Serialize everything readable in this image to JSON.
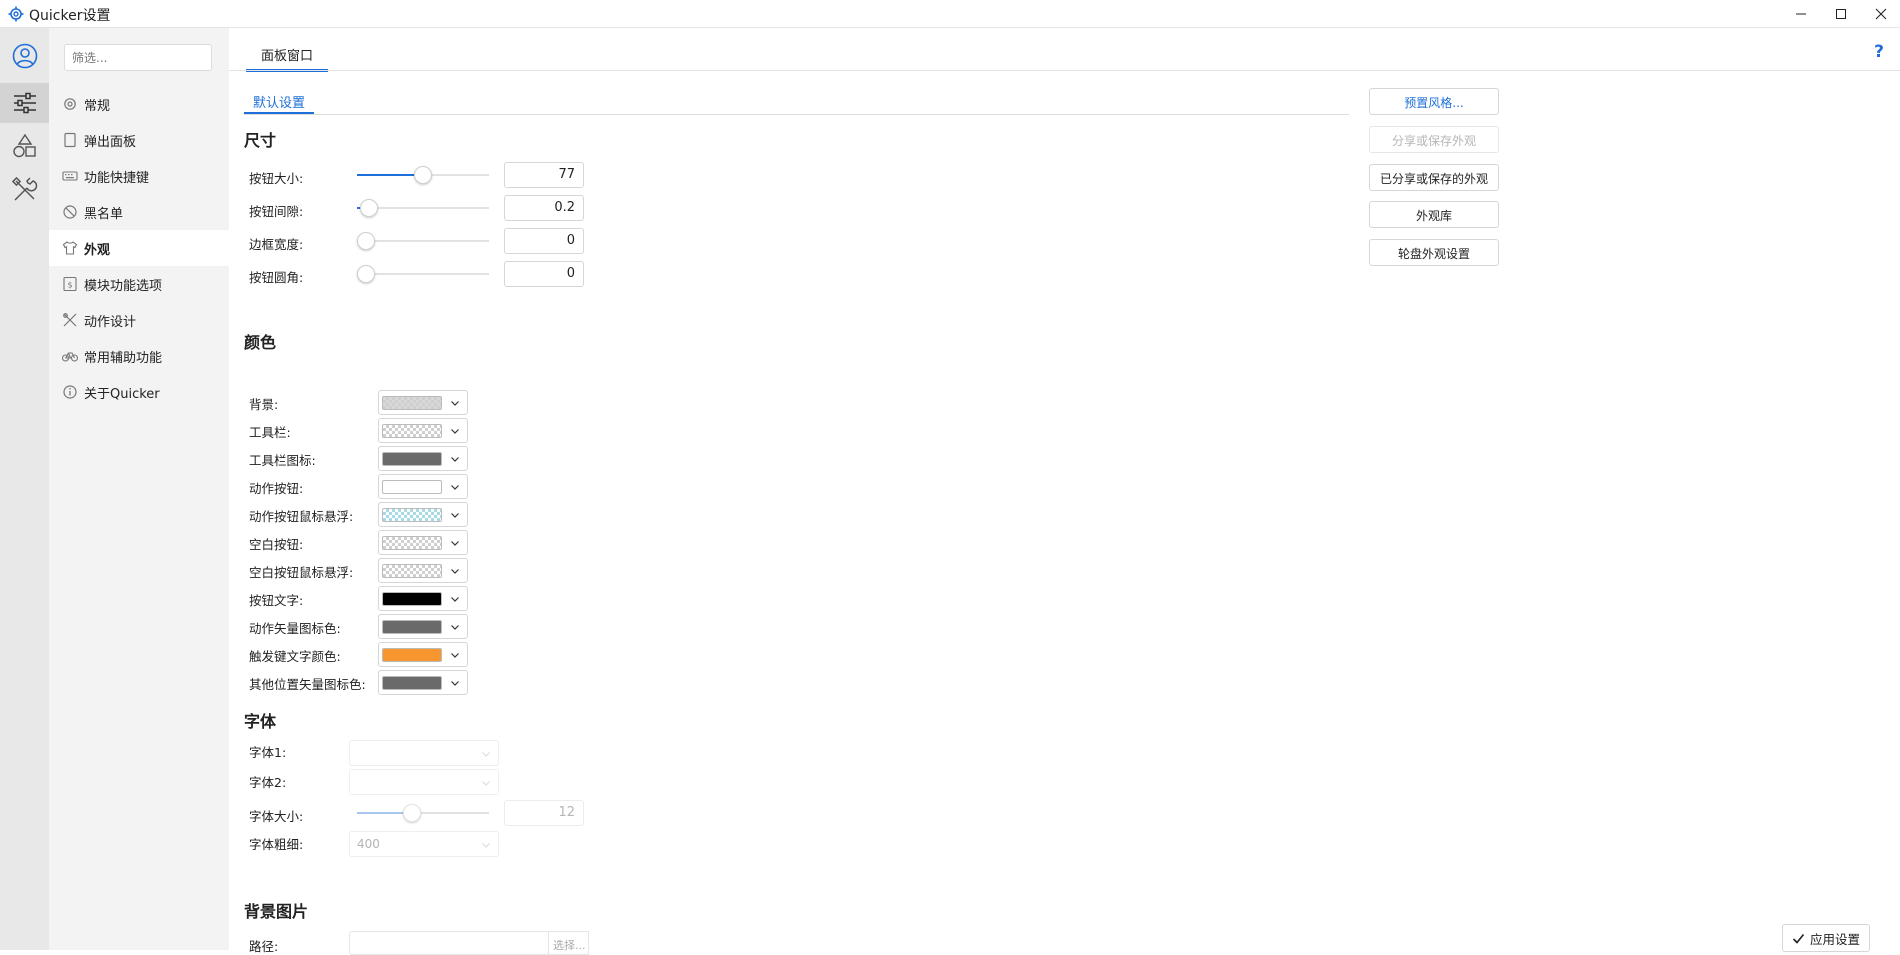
{
  "window": {
    "title": "Quicker设置"
  },
  "sidebar": {
    "filter_placeholder": "筛选...",
    "items": [
      {
        "label": "常规",
        "icon": "gear-icon"
      },
      {
        "label": "弹出面板",
        "icon": "panel-icon"
      },
      {
        "label": "功能快捷键",
        "icon": "keyboard-icon"
      },
      {
        "label": "黑名单",
        "icon": "ban-icon"
      },
      {
        "label": "外观",
        "icon": "shirt-icon",
        "active": true
      },
      {
        "label": "模块功能选项",
        "icon": "module-icon"
      },
      {
        "label": "动作设计",
        "icon": "design-icon"
      },
      {
        "label": "常用辅助功能",
        "icon": "bicycle-icon"
      },
      {
        "label": "关于Quicker",
        "icon": "info-icon"
      }
    ]
  },
  "main": {
    "tab": "面板窗口",
    "help": "?",
    "subtab": "默认设置",
    "size_section": {
      "title": "尺寸",
      "rows": [
        {
          "label": "按钮大小:",
          "value": "77",
          "level": 0.5
        },
        {
          "label": "按钮间隙:",
          "value": "0.2",
          "level": 0.03
        },
        {
          "label": "边框宽度:",
          "value": "0",
          "level": 0
        },
        {
          "label": "按钮圆角:",
          "value": "0",
          "level": 0
        }
      ]
    },
    "color_section": {
      "title": "颜色",
      "rows": [
        {
          "label": "背景:",
          "swatch": "checker-gray"
        },
        {
          "label": "工具栏:",
          "swatch": "checker"
        },
        {
          "label": "工具栏图标:",
          "swatch": "#6a6a6a"
        },
        {
          "label": "动作按钮:",
          "swatch": "#ffffff"
        },
        {
          "label": "动作按钮鼠标悬浮:",
          "swatch": "checker-blue"
        },
        {
          "label": "空白按钮:",
          "swatch": "checker"
        },
        {
          "label": "空白按钮鼠标悬浮:",
          "swatch": "checker"
        },
        {
          "label": "按钮文字:",
          "swatch": "#000000"
        },
        {
          "label": "动作矢量图标色:",
          "swatch": "#6a6a6a"
        },
        {
          "label": "触发键文字颜色:",
          "swatch": "#f7962e"
        },
        {
          "label": "其他位置矢量图标色:",
          "swatch": "#6a6a6a"
        }
      ]
    },
    "font_section": {
      "title": "字体",
      "font1_label": "字体1:",
      "font2_label": "字体2:",
      "size_label": "字体大小:",
      "size_value": "12",
      "size_level": 0.4,
      "weight_label": "字体粗细:",
      "weight_value": "400"
    },
    "bg_section": {
      "title": "背景图片",
      "path_label": "路径:",
      "pick_label": "选择..."
    },
    "right_buttons": {
      "preset": "预置风格...",
      "share": "分享或保存外观",
      "shared": "已分享或保存的外观",
      "library": "外观库",
      "wheel": "轮盘外观设置"
    },
    "apply_label": "应用设置"
  },
  "colors": {
    "accent": "#1e6fd9",
    "sidebar_bg": "#f3f3f3",
    "iconbar_bg": "#e8e8e8"
  }
}
